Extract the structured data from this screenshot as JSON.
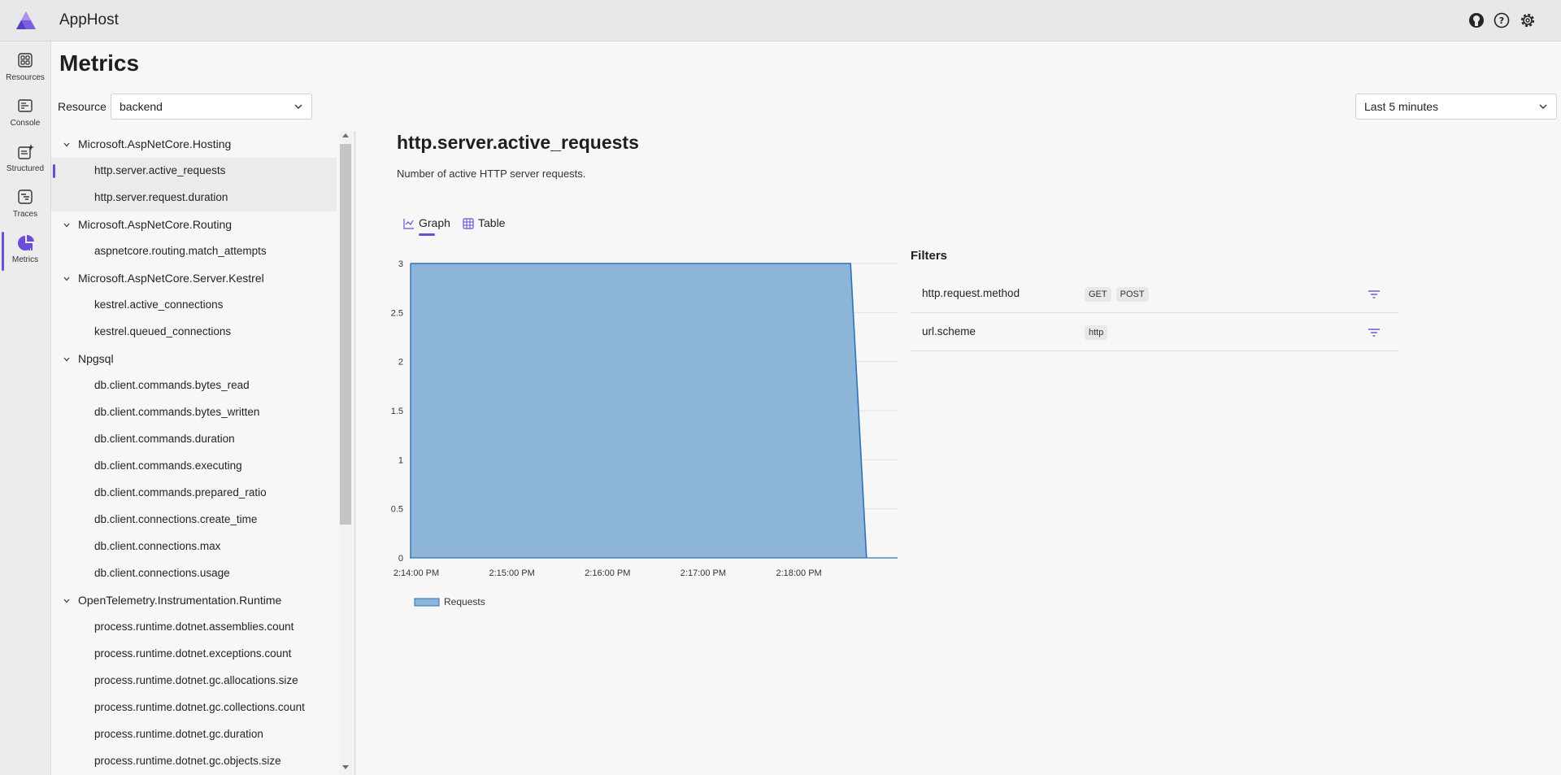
{
  "header": {
    "app_title": "AppHost",
    "icons": [
      "github-icon",
      "help-icon",
      "settings-icon"
    ]
  },
  "nav": {
    "items": [
      {
        "label": "Resources",
        "icon": "grid-icon"
      },
      {
        "label": "Console",
        "icon": "console-icon"
      },
      {
        "label": "Structured",
        "icon": "structured-logs-icon"
      },
      {
        "label": "Traces",
        "icon": "traces-icon"
      },
      {
        "label": "Metrics",
        "icon": "metrics-icon",
        "active": true
      }
    ]
  },
  "page": {
    "title": "Metrics",
    "resource_label": "Resource",
    "resource_value": "backend",
    "time_range": "Last 5 minutes"
  },
  "tree": {
    "groups": [
      {
        "label": "Microsoft.AspNetCore.Hosting",
        "items": [
          "http.server.active_requests",
          "http.server.request.duration"
        ]
      },
      {
        "label": "Microsoft.AspNetCore.Routing",
        "items": [
          "aspnetcore.routing.match_attempts"
        ]
      },
      {
        "label": "Microsoft.AspNetCore.Server.Kestrel",
        "items": [
          "kestrel.active_connections",
          "kestrel.queued_connections"
        ]
      },
      {
        "label": "Npgsql",
        "items": [
          "db.client.commands.bytes_read",
          "db.client.commands.bytes_written",
          "db.client.commands.duration",
          "db.client.commands.executing",
          "db.client.commands.prepared_ratio",
          "db.client.connections.create_time",
          "db.client.connections.max",
          "db.client.connections.usage"
        ]
      },
      {
        "label": "OpenTelemetry.Instrumentation.Runtime",
        "items": [
          "process.runtime.dotnet.assemblies.count",
          "process.runtime.dotnet.exceptions.count",
          "process.runtime.dotnet.gc.allocations.size",
          "process.runtime.dotnet.gc.collections.count",
          "process.runtime.dotnet.gc.duration",
          "process.runtime.dotnet.gc.objects.size"
        ]
      }
    ],
    "selected": "http.server.active_requests"
  },
  "metric": {
    "title": "http.server.active_requests",
    "description": "Number of active HTTP server requests."
  },
  "tabs": {
    "graph": "Graph",
    "table": "Table"
  },
  "chart_data": {
    "type": "area",
    "x": [
      "2:14:00 PM",
      "2:18:36 PM",
      "2:18:46 PM"
    ],
    "x_seconds_note": "",
    "points": [
      {
        "t": 0,
        "y": 3
      },
      {
        "t": 276,
        "y": 3
      },
      {
        "t": 286,
        "y": 0
      }
    ],
    "x_ticks": [
      "2:14:00 PM",
      "2:15:00 PM",
      "2:16:00 PM",
      "2:17:00 PM",
      "2:18:00 PM"
    ],
    "y_ticks": [
      "0",
      "0.5",
      "1",
      "1.5",
      "2",
      "2.5",
      "3"
    ],
    "ylim": [
      0,
      3
    ],
    "series": [
      {
        "name": "Requests"
      }
    ],
    "grid": true,
    "legend": "bottom-left",
    "fill_color": "#8cb5d8",
    "line_color": "#2f73b4"
  },
  "filters": {
    "title": "Filters",
    "rows": [
      {
        "name": "http.request.method",
        "values": [
          "GET",
          "POST"
        ]
      },
      {
        "name": "url.scheme",
        "values": [
          "http"
        ]
      }
    ]
  }
}
